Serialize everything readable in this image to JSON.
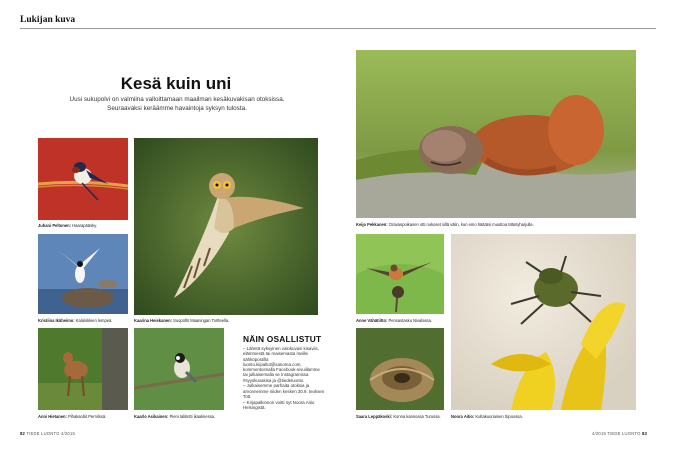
{
  "section_title": "Lukijan kuva",
  "headline": "Kesä kuin uni",
  "intro": "Uusi sukupolvi on valmiina valloittamaan maailman kesäkuvakisan otoksissa. Seuraavaksi keräämme havaintoja syksyn tulosta.",
  "photos": {
    "swallow": {
      "name": "Juhani Peltonen:",
      "desc": "Haarapääsky."
    },
    "owl": {
      "name": "Kaarina Heiskanen:",
      "desc": "Suopöllö Maaningan Tortteella."
    },
    "squirrel": {
      "name": "Keijo Pekkanen:",
      "desc": "Oravanpoikanen otti nokoset sillä välin, kun emo hääräsi muuttoa Mäntyharjulla."
    },
    "tern": {
      "name": "Kristiina Ikäheimo:",
      "desc": "Kalalokkien lempeä."
    },
    "wagtail": {
      "name": "Anne Vähätiitto:",
      "desc": "Pensastasku Nivalassa."
    },
    "bird_nest": {
      "name": "Saara Leppäkoski:",
      "desc": "Konna kannossa Turussa."
    },
    "beetle": {
      "name": "Noora Aitio:",
      "desc": "Kultakuoriainen Sipoossa."
    },
    "fawn": {
      "name": "Anni Hietanen:",
      "desc": "Pihakanbit Pernilssä."
    },
    "titmouse": {
      "name": "Kaarlo Asikainen:",
      "desc": "Pieni talitintti ikaalinessa."
    }
  },
  "info_box": {
    "title": "NÄIN OSALLISTUT",
    "items": [
      "– Lähetä syksyinen valokuvasi kisaviis, elämmestä tai maisemasta meille sähköpostilla luonto.kiipallut@sanoma.com, kommentoimalla Facebook-sivuillamme tai julkaisemalla se Instagramissa #syyskuvakisa ja @tiedeluonto.",
      "– Julkaisemme parhaita otoksia ja arvonnemme niiden kesken 30.9. teoksen Tott.",
      "– Kirjapalkinnon voitti nyt Noora Aitio Helsingistä."
    ]
  },
  "footer": {
    "left_page": "82",
    "left_mag": "TIEDE LUONTO 4/2015",
    "right_mag": "4/2015 TIEDE LUONTO",
    "right_page": "83"
  },
  "colors": {
    "header_rule": "#999999",
    "text": "#1a1a1a"
  }
}
